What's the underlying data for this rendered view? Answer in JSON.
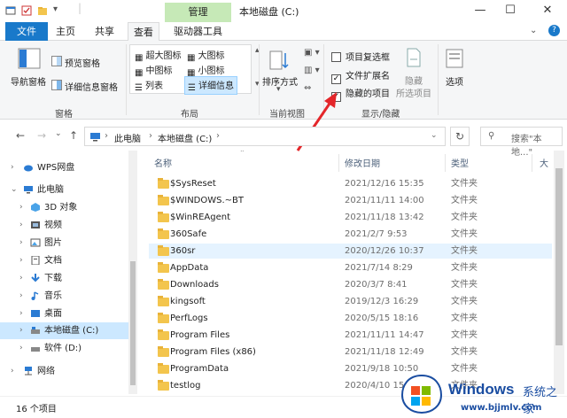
{
  "window": {
    "title": "本地磁盘 (C:)",
    "context_tab": "管理",
    "minimize": "—",
    "maximize": "☐",
    "close": "✕"
  },
  "ribbon_tabs": [
    "文件",
    "主页",
    "共享",
    "查看",
    "驱动器工具"
  ],
  "ribbon": {
    "panes": {
      "nav_pane": "导航窗格",
      "preview_pane": "预览窗格",
      "details_pane": "详细信息窗格",
      "label": "窗格"
    },
    "layout": {
      "extra_large": "超大图标",
      "large": "大图标",
      "medium": "中图标",
      "small": "小图标",
      "list": "列表",
      "details": "详细信息",
      "label": "布局"
    },
    "current_view": {
      "sort_by": "排序方式",
      "label": "当前视图"
    },
    "show_hide": {
      "item_checkboxes": "项目复选框",
      "item_checkboxes_checked": false,
      "file_extensions": "文件扩展名",
      "file_extensions_checked": true,
      "hidden_items": "隐藏的项目",
      "hidden_items_checked": true,
      "hide_selected_1": "隐藏",
      "hide_selected_2": "所选项目",
      "options": "选项",
      "label": "显示/隐藏"
    }
  },
  "address": {
    "crumb1": "此电脑",
    "crumb2": "本地磁盘 (C:)",
    "search_placeholder": "搜索\"本地...\""
  },
  "nav_tree": [
    {
      "label": "WPS网盘",
      "icon": "cloud-icon"
    },
    {
      "label": "此电脑",
      "icon": "computer-icon"
    },
    {
      "label": "3D 对象",
      "icon": "cube-icon"
    },
    {
      "label": "视频",
      "icon": "video-icon"
    },
    {
      "label": "图片",
      "icon": "picture-icon"
    },
    {
      "label": "文档",
      "icon": "document-icon"
    },
    {
      "label": "下载",
      "icon": "download-icon"
    },
    {
      "label": "音乐",
      "icon": "music-icon"
    },
    {
      "label": "桌面",
      "icon": "desktop-icon"
    },
    {
      "label": "本地磁盘 (C:)",
      "icon": "drive-icon"
    },
    {
      "label": "软件 (D:)",
      "icon": "drive-icon"
    },
    {
      "label": "网络",
      "icon": "network-icon"
    }
  ],
  "columns": {
    "name": "名称",
    "date": "修改日期",
    "type": "类型",
    "size": "大"
  },
  "files": [
    {
      "name": "$SysReset",
      "date": "2021/12/16 15:35",
      "type": "文件夹"
    },
    {
      "name": "$WINDOWS.~BT",
      "date": "2021/11/11 14:00",
      "type": "文件夹"
    },
    {
      "name": "$WinREAgent",
      "date": "2021/11/18 13:42",
      "type": "文件夹"
    },
    {
      "name": "360Safe",
      "date": "2021/2/7 9:53",
      "type": "文件夹"
    },
    {
      "name": "360sr",
      "date": "2020/12/26 10:37",
      "type": "文件夹"
    },
    {
      "name": "AppData",
      "date": "2021/7/14 8:29",
      "type": "文件夹"
    },
    {
      "name": "Downloads",
      "date": "2020/3/7 8:41",
      "type": "文件夹"
    },
    {
      "name": "kingsoft",
      "date": "2019/12/3 16:29",
      "type": "文件夹"
    },
    {
      "name": "PerfLogs",
      "date": "2020/5/15 18:16",
      "type": "文件夹"
    },
    {
      "name": "Program Files",
      "date": "2021/11/11 14:47",
      "type": "文件夹"
    },
    {
      "name": "Program Files (x86)",
      "date": "2021/11/18 12:49",
      "type": "文件夹"
    },
    {
      "name": "ProgramData",
      "date": "2021/9/18 10:50",
      "type": "文件夹"
    },
    {
      "name": "testlog",
      "date": "2020/4/10 15:51",
      "type": "文件夹"
    }
  ],
  "status": {
    "count": "16 个项目"
  },
  "watermark": {
    "brand": "Windows",
    "brand_cn": "系统之家",
    "url": "www.bjjmlv.com"
  }
}
